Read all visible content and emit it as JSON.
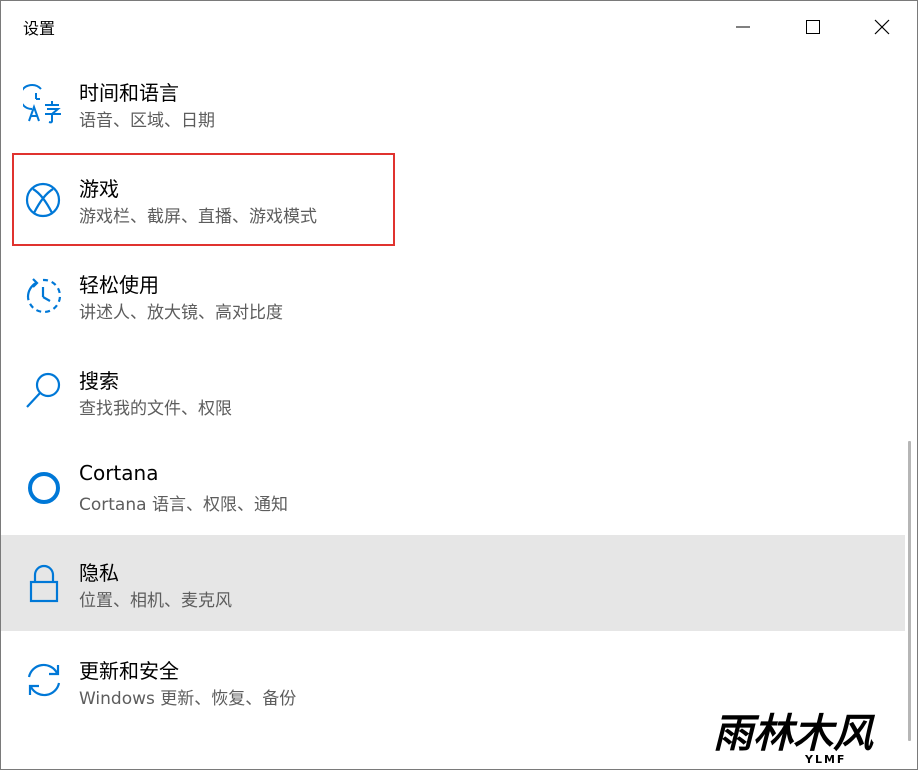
{
  "window": {
    "title": "设置"
  },
  "settings": {
    "items": [
      {
        "label": "时间和语言",
        "desc": "语音、区域、日期",
        "icon": "time-language-icon"
      },
      {
        "label": "游戏",
        "desc": "游戏栏、截屏、直播、游戏模式",
        "icon": "xbox-icon"
      },
      {
        "label": "轻松使用",
        "desc": "讲述人、放大镜、高对比度",
        "icon": "ease-of-access-icon"
      },
      {
        "label": "搜索",
        "desc": "查找我的文件、权限",
        "icon": "search-icon"
      },
      {
        "label": "Cortana",
        "desc": "Cortana 语言、权限、通知",
        "icon": "cortana-icon"
      },
      {
        "label": "隐私",
        "desc": "位置、相机、麦克风",
        "icon": "lock-icon"
      },
      {
        "label": "更新和安全",
        "desc": "Windows 更新、恢复、备份",
        "icon": "sync-icon"
      }
    ],
    "hovered_index": 5,
    "highlighted_index": 1
  },
  "watermark": {
    "text": "雨林木风",
    "subtext": "YLMF"
  },
  "colors": {
    "accent": "#0078d7",
    "highlight_border": "#e0332f",
    "hover_bg": "#e6e6e6",
    "desc_text": "#5d5d5d"
  }
}
